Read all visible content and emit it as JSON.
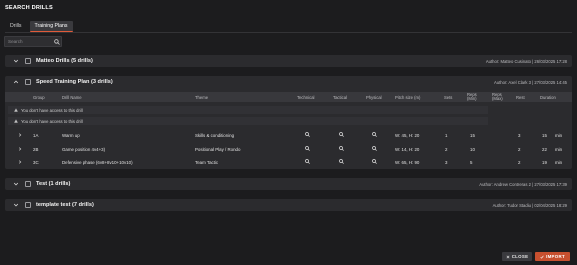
{
  "title": "SEARCH DRILLS",
  "tabs": [
    {
      "label": "Drills",
      "active": false
    },
    {
      "label": "Training Plans",
      "active": true
    }
  ],
  "search": {
    "placeholder": "Search",
    "value": ""
  },
  "plans": [
    {
      "name": "Matteo Drills (5 drills)",
      "meta": "Author: Matteo Cusinato | 26/03/2025 17:28",
      "expanded": false
    },
    {
      "name": "Speed Training Plan (3 drills)",
      "meta": "Author: Axel Clark 3 | 27/03/2025 14:45",
      "expanded": true
    },
    {
      "name": "Test (1 drills)",
      "meta": "Author: Andrew Contreras 2 | 27/03/2025 17:39",
      "expanded": false
    },
    {
      "name": "template test (7 drills)",
      "meta": "Author: Tudor Stadiu | 02/04/2025 18:29",
      "expanded": false
    }
  ],
  "columns": {
    "group": "Group",
    "drill": "Drill Name",
    "theme": "Theme",
    "technical": "Technical",
    "tactical": "Tactical",
    "physical": "Physical",
    "pitch": "Pitch size (m)",
    "sets": "Sets",
    "reps_min": "Reps (Min)",
    "reps_max": "Reps (Max)",
    "rest": "Rest",
    "duration": "Duration"
  },
  "warnings": [
    "You don't have access to this drill",
    "You don't have access to this drill"
  ],
  "drills": [
    {
      "group": "1A",
      "name": "Warm up",
      "theme": "Skills & conditioning",
      "pitch": "W: 45, H: 20",
      "sets": "1",
      "reps": "15",
      "rest": "3",
      "duration": "15",
      "unit": "min"
    },
    {
      "group": "2B",
      "name": "Game position 4v4+3)",
      "theme": "Positional Play / Rondo",
      "pitch": "W: 14, H: 20",
      "sets": "2",
      "reps": "10",
      "rest": "2",
      "duration": "22",
      "unit": "min"
    },
    {
      "group": "3C",
      "name": "Defensive phase (6v8+8v10+10v10)",
      "theme": "Team Tactic",
      "pitch": "W: 65, H: 90",
      "sets": "3",
      "reps": "5",
      "rest": "2",
      "duration": "19",
      "unit": "min"
    }
  ],
  "buttons": {
    "close": "CLOSE",
    "import": "IMPORT"
  },
  "icons": [
    "search-icon",
    "chevron-down-icon",
    "chevron-up-icon",
    "chevron-right-icon",
    "warning-icon",
    "magnifier-icon",
    "close-icon",
    "check-icon"
  ],
  "colors": {
    "accent": "#c8502f",
    "background": "#1c1c1e",
    "panel": "#2b2b2e"
  }
}
